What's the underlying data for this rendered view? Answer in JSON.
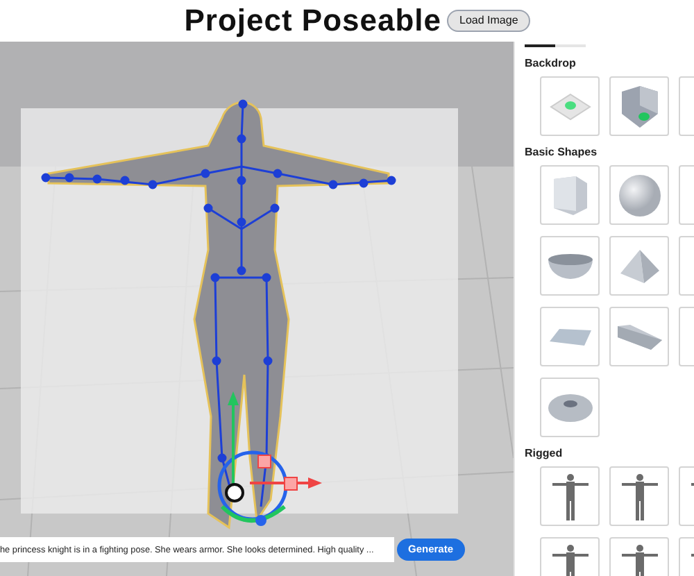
{
  "header": {
    "title": "Project Poseable",
    "load_button": "Load Image"
  },
  "viewport": {
    "prompt": {
      "value": "he princess knight is in a fighting pose. She wears armor. She looks determined. High quality ..."
    },
    "generate_button": "Generate"
  },
  "panel": {
    "tabs": [
      {
        "selected": true
      },
      {
        "selected": false
      }
    ],
    "sections": [
      {
        "title": "Backdrop",
        "items": [
          {
            "kind": "floor"
          },
          {
            "kind": "corner"
          },
          {
            "kind": "hidden"
          }
        ]
      },
      {
        "title": "Basic Shapes",
        "items": [
          {
            "kind": "cube"
          },
          {
            "kind": "sphere"
          },
          {
            "kind": "hidden"
          },
          {
            "kind": "bowl"
          },
          {
            "kind": "pyramid"
          },
          {
            "kind": "hidden"
          },
          {
            "kind": "plane"
          },
          {
            "kind": "ramp"
          },
          {
            "kind": "hidden"
          },
          {
            "kind": "torus"
          }
        ]
      },
      {
        "title": "Rigged",
        "items": [
          {
            "kind": "figure"
          },
          {
            "kind": "figure"
          },
          {
            "kind": "figure"
          },
          {
            "kind": "figure"
          },
          {
            "kind": "figure"
          },
          {
            "kind": "figure"
          }
        ]
      }
    ]
  }
}
